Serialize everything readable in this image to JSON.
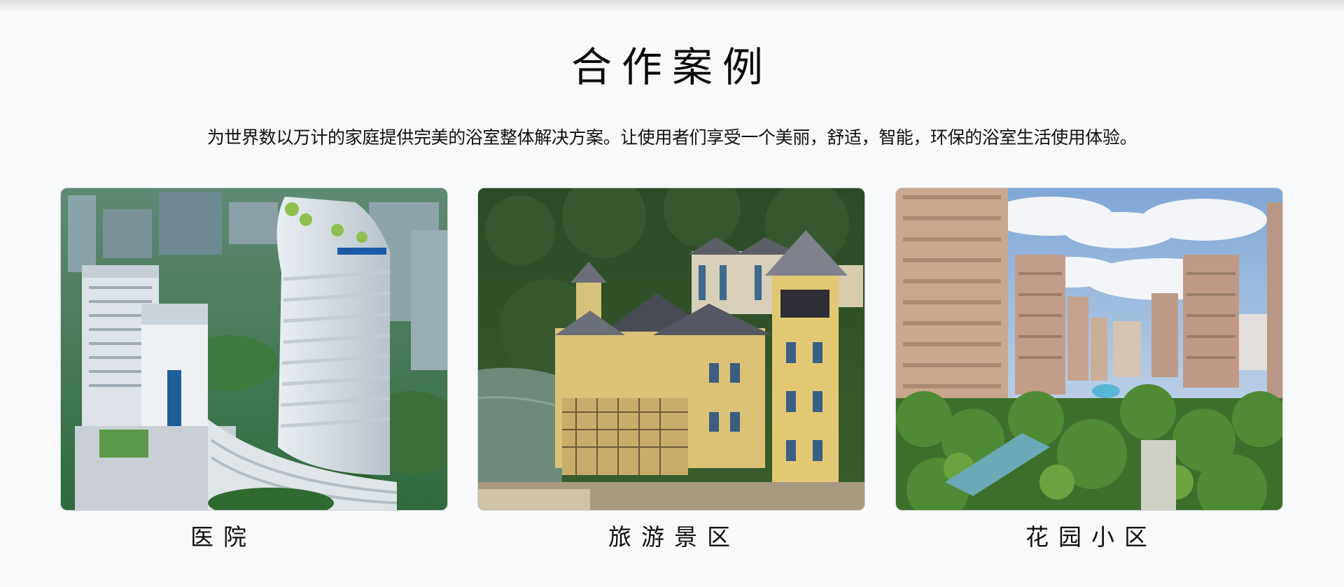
{
  "section": {
    "title": "合作案例",
    "subtitle": "为世界数以万计的家庭提供完美的浴室整体解决方案。让使用者们享受一个美丽，舒适，智能，环保的浴室生活使用体验。"
  },
  "cases": [
    {
      "label": "医院",
      "image": "hospital-buildings-photo"
    },
    {
      "label": "旅游景区",
      "image": "scenic-resort-villas-photo"
    },
    {
      "label": "花园小区",
      "image": "garden-residential-towers-photo"
    }
  ],
  "colors": {
    "background": "#f8f9fa",
    "text": "#111111",
    "card_border": "#cfd3d8"
  }
}
